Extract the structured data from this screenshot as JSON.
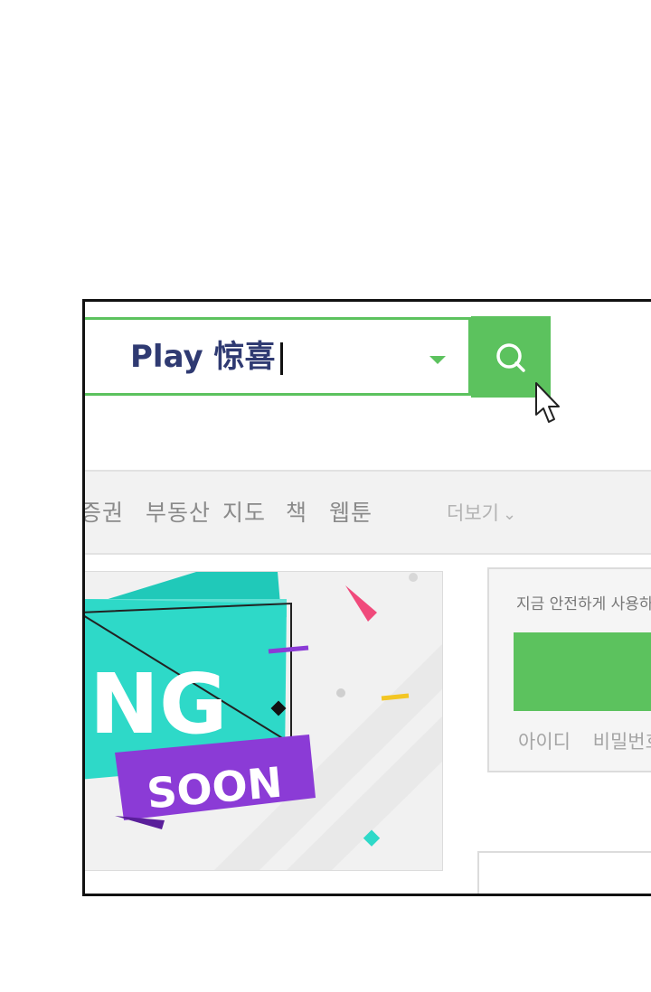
{
  "search": {
    "value": "Play 惊喜"
  },
  "nav": {
    "items": [
      "증권",
      "부동산",
      "지도",
      "책",
      "웹툰"
    ],
    "more_label": "더보기"
  },
  "banner": {
    "big_text": "NG",
    "ribbon_text": "SOON"
  },
  "login": {
    "prompt": "지금 안전하게 사용하",
    "links": [
      "아이디",
      "비밀번호"
    ]
  },
  "colors": {
    "brand_green": "#5cc25e",
    "banner_teal": "#2ed9c8",
    "banner_purple": "#8b3bd6",
    "search_text": "#2f3a72"
  },
  "icons": [
    "search-icon",
    "dropdown-arrow-icon",
    "cursor-icon",
    "chevron-down-icon"
  ]
}
